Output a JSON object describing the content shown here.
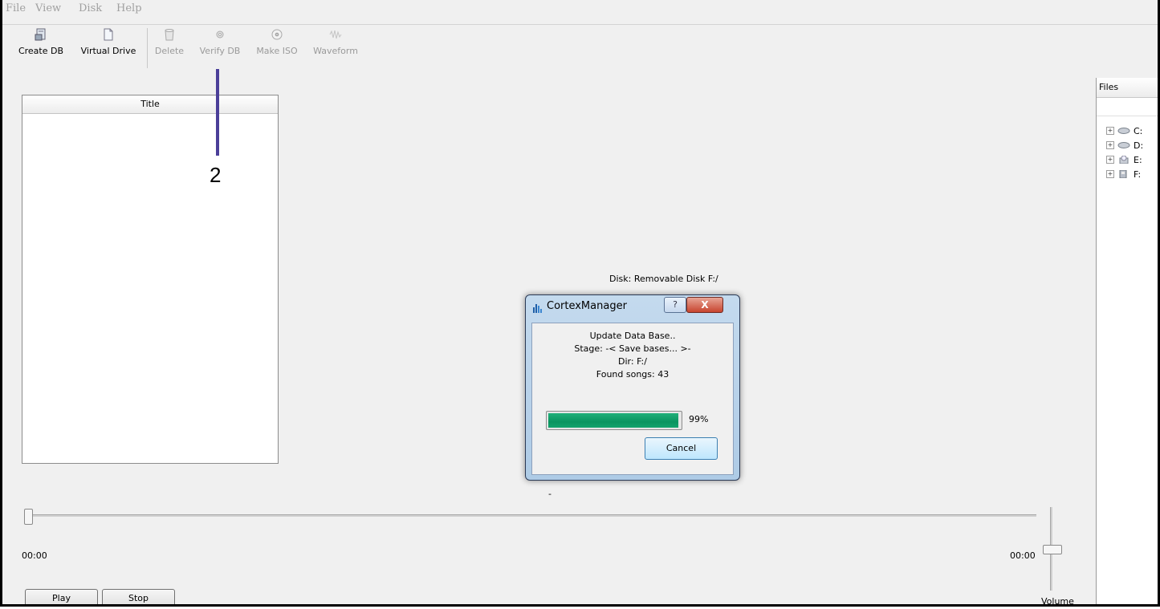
{
  "menu": {
    "file": "File",
    "view": "View",
    "disk": "Disk",
    "help": "Help"
  },
  "toolbar": {
    "create_db": "Create DB",
    "virtual_drive": "Virtual Drive",
    "delete": "Delete",
    "verify_db": "Verify DB",
    "make_iso": "Make ISO",
    "waveform": "Waveform"
  },
  "list": {
    "title_header": "Title"
  },
  "annotation": {
    "number": "2"
  },
  "files": {
    "header": "Files",
    "drives": [
      {
        "label": "C:",
        "icon": "hard-drive-icon"
      },
      {
        "label": "D:",
        "icon": "hard-drive-icon"
      },
      {
        "label": "E:",
        "icon": "optical-drive-icon"
      },
      {
        "label": "F:",
        "icon": "removable-drive-icon"
      }
    ]
  },
  "main": {
    "disk_label": "Disk: Removable Disk F:/",
    "dash": "-"
  },
  "player": {
    "time_left": "00:00",
    "time_right": "00:00",
    "volume_label": "Volume",
    "play": "Play",
    "stop": "Stop",
    "position_fraction": 0.0,
    "volume_fraction": 0.5
  },
  "dialog": {
    "title": "CortexManager",
    "help_glyph": "?",
    "close_glyph": "X",
    "line1": "Update Data Base..",
    "line2": "Stage: -< Save bases... >-",
    "line3": "Dir: F:/",
    "line4": "Found songs: 43",
    "progress_value": 99,
    "progress_label": "99%",
    "cancel": "Cancel"
  },
  "colors": {
    "progress": "#0a9460",
    "annotation": "#4b3f99",
    "close": "#c7442e"
  }
}
